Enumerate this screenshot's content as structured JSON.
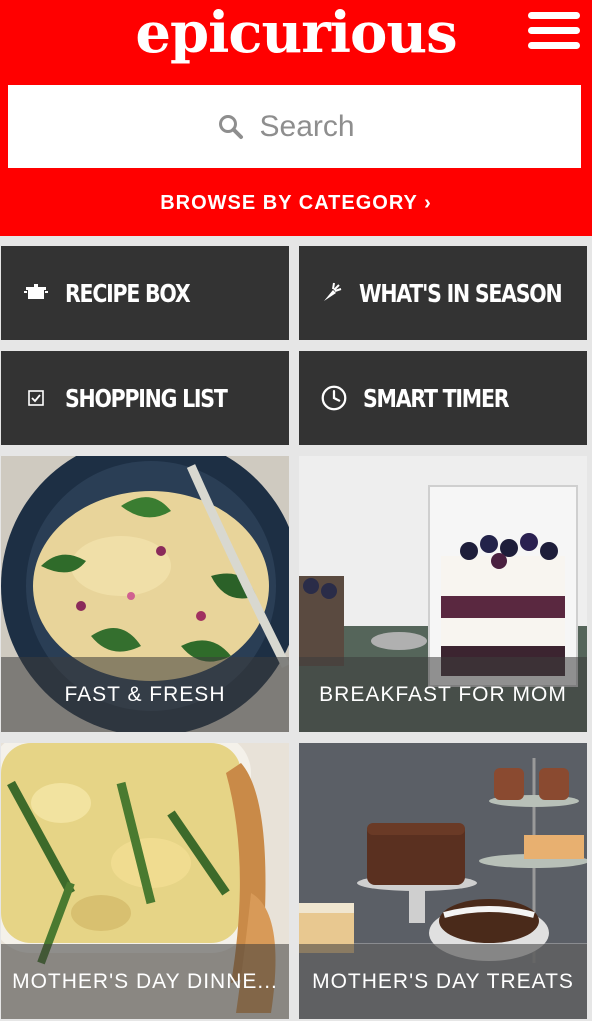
{
  "header": {
    "logo_text": "epicurious",
    "menu_icon": "hamburger-menu-icon",
    "search": {
      "placeholder": "Search",
      "value": "",
      "icon": "search-icon"
    },
    "browse_label": "BROWSE BY CATEGORY ›",
    "bg_color": "#ff0000"
  },
  "tiles": [
    {
      "label": "RECIPE BOX",
      "icon": "recipe-box-icon"
    },
    {
      "label": "WHAT'S IN SEASON",
      "icon": "carrot-icon"
    },
    {
      "label": "SHOPPING LIST",
      "icon": "checklist-icon"
    },
    {
      "label": "SMART TIMER",
      "icon": "clock-icon"
    }
  ],
  "cards": [
    {
      "label": "FAST & FRESH"
    },
    {
      "label": "BREAKFAST FOR MOM"
    },
    {
      "label": "MOTHER'S DAY DINNE..."
    },
    {
      "label": "MOTHER'S DAY TREATS"
    }
  ]
}
